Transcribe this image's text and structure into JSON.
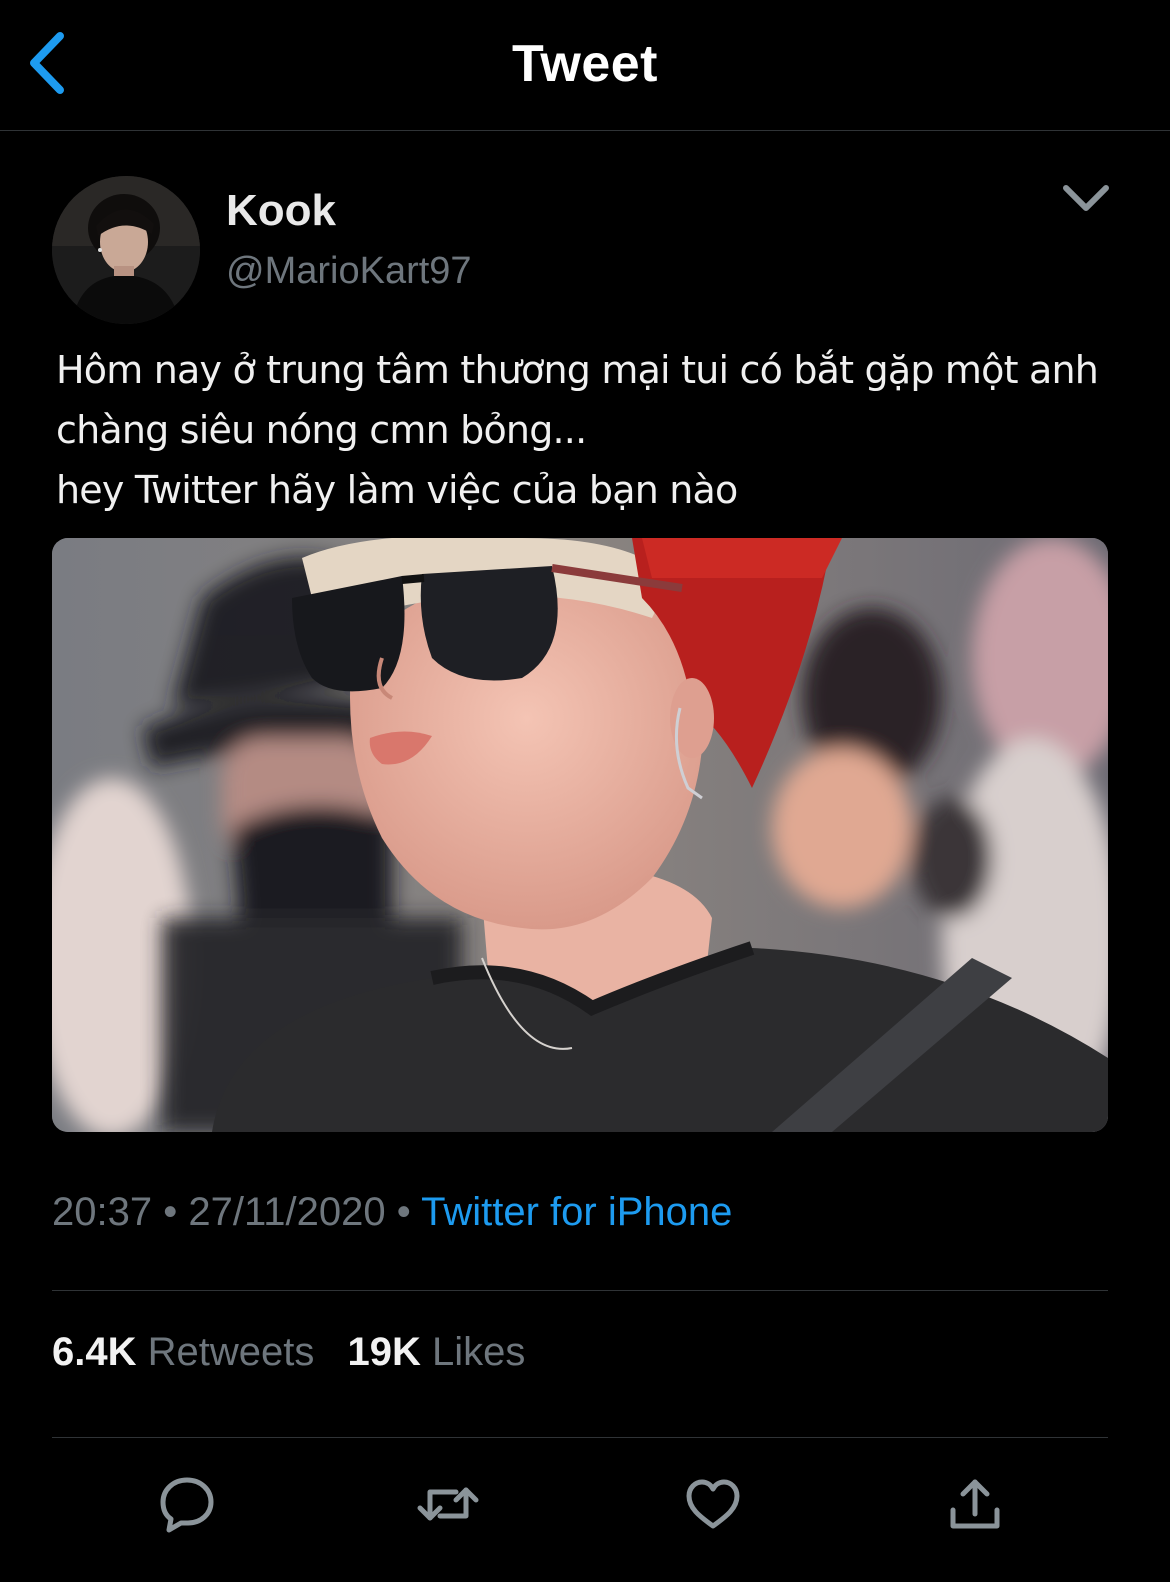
{
  "header": {
    "title": "Tweet",
    "back_icon": "chevron-left-icon",
    "accent_color": "#1d9bf0"
  },
  "tweet": {
    "author": {
      "display_name": "Kook",
      "handle": "@MarioKart97"
    },
    "text_lines": [
      "Hôm nay ở trung tâm thương mại tui có bắt gặp một anh",
      "chàng siêu nóng cmn bỏng...",
      "hey Twitter hãy làm việc của bạn nào"
    ],
    "time": "20:37",
    "separator": "•",
    "date": "27/11/2020",
    "source": "Twitter for iPhone",
    "stats": {
      "retweets_count": "6.4K",
      "retweets_label": "Retweets",
      "likes_count": "19K",
      "likes_label": "Likes"
    }
  },
  "actions": [
    "reply-icon",
    "retweet-icon",
    "like-icon",
    "share-icon"
  ],
  "colors": {
    "background": "#000000",
    "text": "#ffffff",
    "muted": "#6e767d",
    "link": "#1d9bf0",
    "divider": "#2f3336"
  }
}
